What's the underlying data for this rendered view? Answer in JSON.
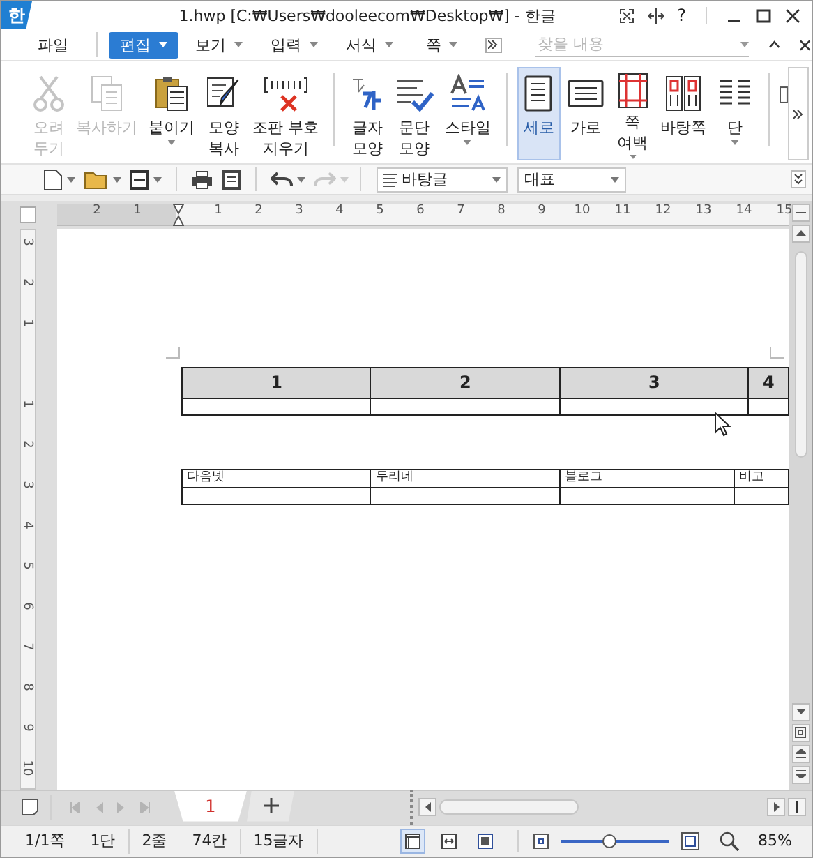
{
  "window": {
    "app_logo": "한",
    "title": "1.hwp [C:₩Users₩dooleecom₩Desktop₩] - 한글",
    "help": "?"
  },
  "menu": {
    "items": [
      {
        "label": "파일",
        "selected": false,
        "has_menu": false
      },
      {
        "label": "편집",
        "selected": true,
        "has_menu": true
      },
      {
        "label": "보기",
        "selected": false,
        "has_menu": true
      },
      {
        "label": "입력",
        "selected": false,
        "has_menu": true
      },
      {
        "label": "서식",
        "selected": false,
        "has_menu": true
      },
      {
        "label": "쪽",
        "selected": false,
        "has_menu": true
      }
    ],
    "search": {
      "placeholder": "찾을 내용"
    }
  },
  "ribbon": {
    "groups": [
      {
        "items": [
          {
            "label": [
              "오려",
              "두기"
            ],
            "disabled": true,
            "selected": false,
            "has_menu": false
          },
          {
            "label": [
              "복사하기"
            ],
            "disabled": true,
            "selected": false,
            "has_menu": false
          },
          {
            "label": [
              "붙이기"
            ],
            "disabled": false,
            "selected": false,
            "has_menu": true
          },
          {
            "label": [
              "모양",
              "복사"
            ],
            "disabled": false,
            "selected": false,
            "has_menu": false
          },
          {
            "label": [
              "조판 부호",
              "지우기"
            ],
            "disabled": false,
            "selected": false,
            "has_menu": false
          }
        ]
      },
      {
        "items": [
          {
            "label": [
              "글자",
              "모양"
            ],
            "disabled": false,
            "selected": false,
            "has_menu": false
          },
          {
            "label": [
              "문단",
              "모양"
            ],
            "disabled": false,
            "selected": false,
            "has_menu": false
          },
          {
            "label": [
              "스타일"
            ],
            "disabled": false,
            "selected": false,
            "has_menu": true
          }
        ]
      },
      {
        "items": [
          {
            "label": [
              "세로"
            ],
            "disabled": false,
            "selected": true,
            "has_menu": false
          },
          {
            "label": [
              "가로"
            ],
            "disabled": false,
            "selected": false,
            "has_menu": false
          },
          {
            "label": [
              "쪽",
              "여백"
            ],
            "disabled": false,
            "selected": false,
            "has_menu": true
          },
          {
            "label": [
              "바탕쪽"
            ],
            "disabled": false,
            "selected": false,
            "has_menu": false
          },
          {
            "label": [
              "단"
            ],
            "disabled": false,
            "selected": false,
            "has_menu": true
          }
        ]
      }
    ]
  },
  "toolbar": {
    "buttons": [
      {
        "disabled": false,
        "has_menu": true
      },
      {
        "disabled": false,
        "has_menu": true
      },
      {
        "disabled": false,
        "has_menu": true
      },
      {
        "disabled": false,
        "has_menu": false
      },
      {
        "disabled": false,
        "has_menu": false
      },
      {
        "disabled": false,
        "has_menu": true
      },
      {
        "disabled": true,
        "has_menu": true
      }
    ],
    "style_select": "바탕글",
    "font_select": "대표"
  },
  "ruler": {
    "left_labels": [
      "2",
      "1"
    ],
    "right_labels": [
      "1",
      "2",
      "3",
      "4",
      "5",
      "6",
      "7",
      "8",
      "9",
      "10",
      "11",
      "12",
      "13",
      "14",
      "15"
    ],
    "vertical_top_labels": [
      "3",
      "2",
      "1"
    ],
    "vertical_labels": [
      "1",
      "2",
      "3",
      "4",
      "5",
      "6",
      "7",
      "8",
      "9",
      "10"
    ]
  },
  "document": {
    "tables": [
      {
        "kind": "shaded",
        "header": [
          "1",
          "2",
          "3",
          "4"
        ],
        "blank_row": true
      },
      {
        "kind": "plain",
        "header": [
          "다음넷",
          "두리네",
          "블로그",
          "비고"
        ],
        "blank_row": true
      }
    ]
  },
  "page_tabs": {
    "nav": [
      {
        "disabled": true
      },
      {
        "disabled": true
      },
      {
        "disabled": true
      },
      {
        "disabled": true
      }
    ],
    "tabs": [
      {
        "label": "1",
        "selected": true
      }
    ]
  },
  "status_bar": {
    "items": [
      "1/1쪽",
      "1단",
      "2줄",
      "74칸",
      "15글자"
    ],
    "views": [
      {
        "selected": true
      },
      {
        "selected": false
      },
      {
        "selected": false
      }
    ],
    "zoom": {
      "level": 0.45,
      "reading": "85%"
    }
  }
}
